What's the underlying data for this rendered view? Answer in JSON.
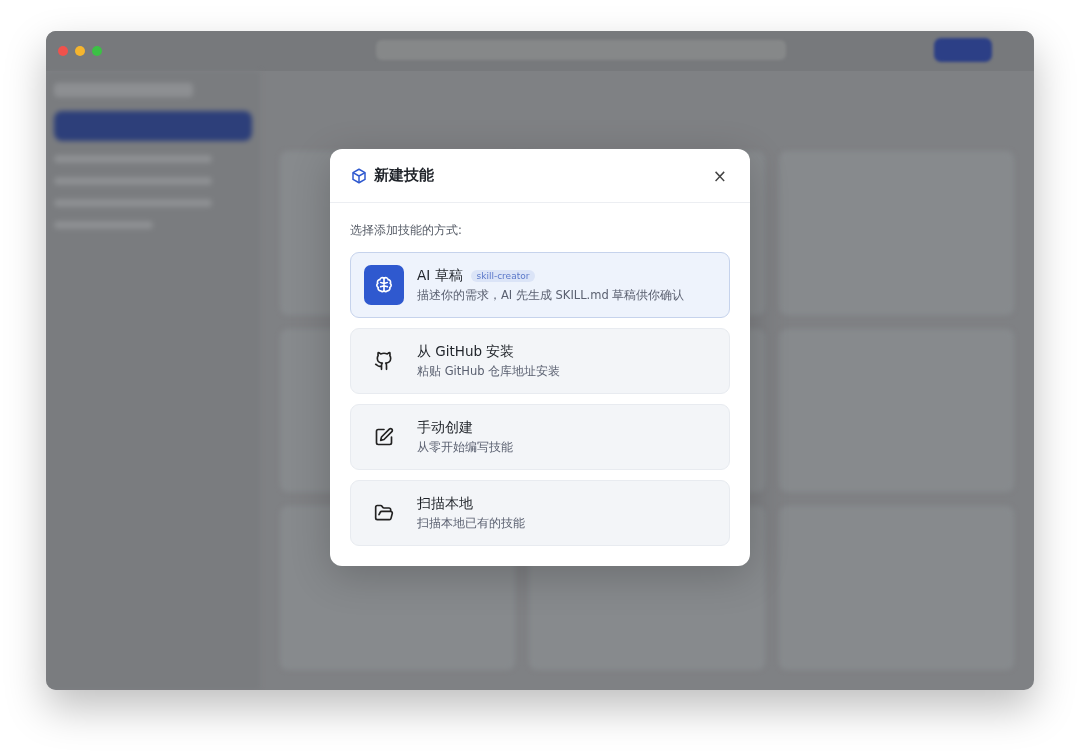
{
  "dialog": {
    "title": "新建技能",
    "close": "×",
    "prompt": "选择添加技能的方式:",
    "options": [
      {
        "kind": "ai",
        "title": "AI 草稿",
        "badge": "skill-creator",
        "description": "描述你的需求，AI 先生成 SKILL.md 草稿供你确认",
        "selected": true
      },
      {
        "kind": "github",
        "title": "从 GitHub 安装",
        "description": "粘贴 GitHub 仓库地址安装",
        "selected": false
      },
      {
        "kind": "manual",
        "title": "手动创建",
        "description": "从零开始编写技能",
        "selected": false
      },
      {
        "kind": "scan",
        "title": "扫描本地",
        "description": "扫描本地已有的技能",
        "selected": false
      }
    ]
  }
}
